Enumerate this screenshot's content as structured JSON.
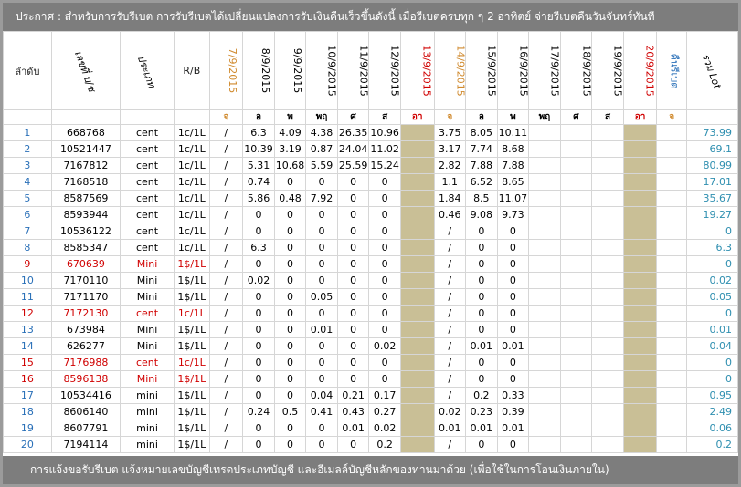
{
  "banner": {
    "text": "ประกาศ : สำหรับการรับรีเบต  การรับรีเบตได้เปลี่ยนแปลงการรับเงินคืนเร็วขึ้นดังนี้    เมื่อรีเบตครบทุก ๆ 2 อาทิตย์ จ่ายรีเบตคืนวันจันทร์ทันที"
  },
  "footer": {
    "text": "การแจ้งขอรับรีเบต  แจ้งหมายเลขบัญชีเทรดประเภทบัญชี และอีเมลล์บัญชีหลักของท่านมาด้วย   (เพื่อใช้ในการโอนเงินภายใน)"
  },
  "headers": {
    "index": "ลำดับ",
    "account": "เลขที่ บ/ช",
    "type": "ประเภท",
    "rb": "R/B",
    "dates": [
      "7/9/2015",
      "8/9/2015",
      "9/9/2015",
      "10/9/2015",
      "11/9/2015",
      "12/9/2015",
      "13/9/2015",
      "14/9/2015",
      "15/9/2015",
      "16/9/2015",
      "17/9/2015",
      "18/9/2015",
      "19/9/2015",
      "20/9/2015"
    ],
    "refund": "คืนรีเบต",
    "total": "รวม Lot"
  },
  "days": [
    "จ",
    "อ",
    "พ",
    "พฤ",
    "ศ",
    "ส",
    "อา",
    "จ",
    "อ",
    "พ",
    "พฤ",
    "ศ",
    "ส",
    "อา",
    "จ"
  ],
  "colors": {
    "banner": "#7d7d7d",
    "orange": "#d08a2e",
    "red": "#d00000",
    "blue": "#2a70b8",
    "tan": "#c9bf96"
  },
  "rows": [
    {
      "n": "1",
      "acc": "668768",
      "type": "cent",
      "rb": "1c/1L",
      "d0": "/",
      "d1": "6.3",
      "d2": "4.09",
      "d3": "4.38",
      "d4": "26.35",
      "d5": "10.96",
      "d7": "3.75",
      "d8": "8.05",
      "d9": "10.11",
      "total": "73.99"
    },
    {
      "n": "2",
      "acc": "10521447",
      "type": "cent",
      "rb": "1c/1L",
      "d0": "/",
      "d1": "10.39",
      "d2": "3.19",
      "d3": "0.87",
      "d4": "24.04",
      "d5": "11.02",
      "d7": "3.17",
      "d8": "7.74",
      "d9": "8.68",
      "total": "69.1"
    },
    {
      "n": "3",
      "acc": "7167812",
      "type": "cent",
      "rb": "1c/1L",
      "d0": "/",
      "d1": "5.31",
      "d2": "10.68",
      "d3": "5.59",
      "d4": "25.59",
      "d5": "15.24",
      "d7": "2.82",
      "d8": "7.88",
      "d9": "7.88",
      "total": "80.99"
    },
    {
      "n": "4",
      "acc": "7168518",
      "type": "cent",
      "rb": "1c/1L",
      "d0": "/",
      "d1": "0.74",
      "d2": "0",
      "d3": "0",
      "d4": "0",
      "d5": "0",
      "d7": "1.1",
      "d8": "6.52",
      "d9": "8.65",
      "total": "17.01"
    },
    {
      "n": "5",
      "acc": "8587569",
      "type": "cent",
      "rb": "1c/1L",
      "d0": "/",
      "d1": "5.86",
      "d2": "0.48",
      "d3": "7.92",
      "d4": "0",
      "d5": "0",
      "d7": "1.84",
      "d8": "8.5",
      "d9": "11.07",
      "total": "35.67"
    },
    {
      "n": "6",
      "acc": "8593944",
      "type": "cent",
      "rb": "1c/1L",
      "d0": "/",
      "d1": "0",
      "d2": "0",
      "d3": "0",
      "d4": "0",
      "d5": "0",
      "d7": "0.46",
      "d8": "9.08",
      "d9": "9.73",
      "total": "19.27"
    },
    {
      "n": "7",
      "acc": "10536122",
      "type": "cent",
      "rb": "1c/1L",
      "d0": "/",
      "d1": "0",
      "d2": "0",
      "d3": "0",
      "d4": "0",
      "d5": "0",
      "d7": "/",
      "d8": "0",
      "d9": "0",
      "total": "0"
    },
    {
      "n": "8",
      "acc": "8585347",
      "type": "cent",
      "rb": "1c/1L",
      "d0": "/",
      "d1": "6.3",
      "d2": "0",
      "d3": "0",
      "d4": "0",
      "d5": "0",
      "d7": "/",
      "d8": "0",
      "d9": "0",
      "total": "6.3"
    },
    {
      "n": "9",
      "acc": "670639",
      "type": "Mini",
      "rb": "1$/1L",
      "d0": "/",
      "d1": "0",
      "d2": "0",
      "d3": "0",
      "d4": "0",
      "d5": "0",
      "d7": "/",
      "d8": "0",
      "d9": "0",
      "total": "0",
      "red": true
    },
    {
      "n": "10",
      "acc": "7170110",
      "type": "Mini",
      "rb": "1$/1L",
      "d0": "/",
      "d1": "0.02",
      "d2": "0",
      "d3": "0",
      "d4": "0",
      "d5": "0",
      "d7": "/",
      "d8": "0",
      "d9": "0",
      "total": "0.02"
    },
    {
      "n": "11",
      "acc": "7171170",
      "type": "Mini",
      "rb": "1$/1L",
      "d0": "/",
      "d1": "0",
      "d2": "0",
      "d3": "0.05",
      "d4": "0",
      "d5": "0",
      "d7": "/",
      "d8": "0",
      "d9": "0",
      "total": "0.05"
    },
    {
      "n": "12",
      "acc": "7172130",
      "type": "cent",
      "rb": "1c/1L",
      "d0": "/",
      "d1": "0",
      "d2": "0",
      "d3": "0",
      "d4": "0",
      "d5": "0",
      "d7": "/",
      "d8": "0",
      "d9": "0",
      "total": "0",
      "red": true
    },
    {
      "n": "13",
      "acc": "673984",
      "type": "Mini",
      "rb": "1$/1L",
      "d0": "/",
      "d1": "0",
      "d2": "0",
      "d3": "0.01",
      "d4": "0",
      "d5": "0",
      "d7": "/",
      "d8": "0",
      "d9": "0",
      "total": "0.01"
    },
    {
      "n": "14",
      "acc": "626277",
      "type": "Mini",
      "rb": "1$/1L",
      "d0": "/",
      "d1": "0",
      "d2": "0",
      "d3": "0",
      "d4": "0",
      "d5": "0.02",
      "d7": "/",
      "d8": "0.01",
      "d9": "0.01",
      "total": "0.04"
    },
    {
      "n": "15",
      "acc": "7176988",
      "type": "cent",
      "rb": "1c/1L",
      "d0": "/",
      "d1": "0",
      "d2": "0",
      "d3": "0",
      "d4": "0",
      "d5": "0",
      "d7": "/",
      "d8": "0",
      "d9": "0",
      "total": "0",
      "red": true
    },
    {
      "n": "16",
      "acc": "8596138",
      "type": "Mini",
      "rb": "1$/1L",
      "d0": "/",
      "d1": "0",
      "d2": "0",
      "d3": "0",
      "d4": "0",
      "d5": "0",
      "d7": "/",
      "d8": "0",
      "d9": "0",
      "total": "0",
      "red": true
    },
    {
      "n": "17",
      "acc": "10534416",
      "type": "mini",
      "rb": "1$/1L",
      "d0": "/",
      "d1": "0",
      "d2": "0",
      "d3": "0.04",
      "d4": "0.21",
      "d5": "0.17",
      "d7": "/",
      "d8": "0.2",
      "d9": "0.33",
      "total": "0.95"
    },
    {
      "n": "18",
      "acc": "8606140",
      "type": "mini",
      "rb": "1$/1L",
      "d0": "/",
      "d1": "0.24",
      "d2": "0.5",
      "d3": "0.41",
      "d4": "0.43",
      "d5": "0.27",
      "d7": "0.02",
      "d8": "0.23",
      "d9": "0.39",
      "total": "2.49"
    },
    {
      "n": "19",
      "acc": "8607791",
      "type": "mini",
      "rb": "1$/1L",
      "d0": "/",
      "d1": "0",
      "d2": "0",
      "d3": "0",
      "d4": "0.01",
      "d5": "0.02",
      "d7": "0.01",
      "d8": "0.01",
      "d9": "0.01",
      "total": "0.06"
    },
    {
      "n": "20",
      "acc": "7194114",
      "type": "mini",
      "rb": "1$/1L",
      "d0": "/",
      "d1": "0",
      "d2": "0",
      "d3": "0",
      "d4": "0",
      "d5": "0.2",
      "d7": "/",
      "d8": "0",
      "d9": "0",
      "total": "0.2"
    }
  ]
}
